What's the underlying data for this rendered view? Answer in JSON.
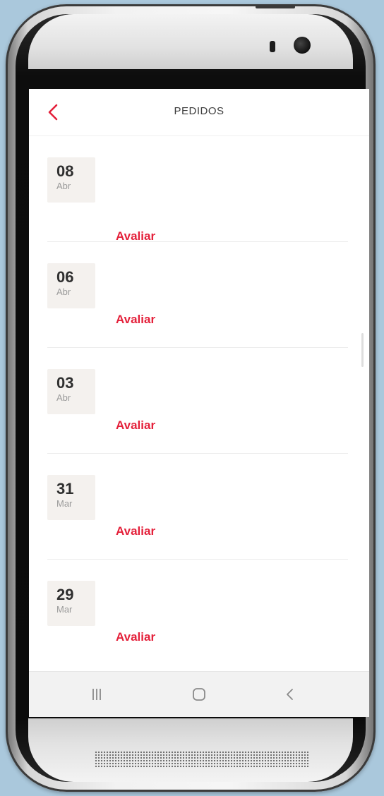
{
  "header": {
    "title": "PEDIDOS",
    "back_icon": "chevron-left-icon"
  },
  "orders": [
    {
      "day": "08",
      "month": "Abr",
      "action": "Avaliar"
    },
    {
      "day": "06",
      "month": "Abr",
      "action": "Avaliar"
    },
    {
      "day": "03",
      "month": "Abr",
      "action": "Avaliar"
    },
    {
      "day": "31",
      "month": "Mar",
      "action": "Avaliar"
    },
    {
      "day": "29",
      "month": "Mar",
      "action": "Avaliar"
    }
  ],
  "nav": {
    "recent_icon": "recent-apps-icon",
    "home_icon": "home-icon",
    "back_icon": "back-icon"
  },
  "colors": {
    "accent": "#e4203a",
    "badge_bg": "#f4f1ee"
  }
}
